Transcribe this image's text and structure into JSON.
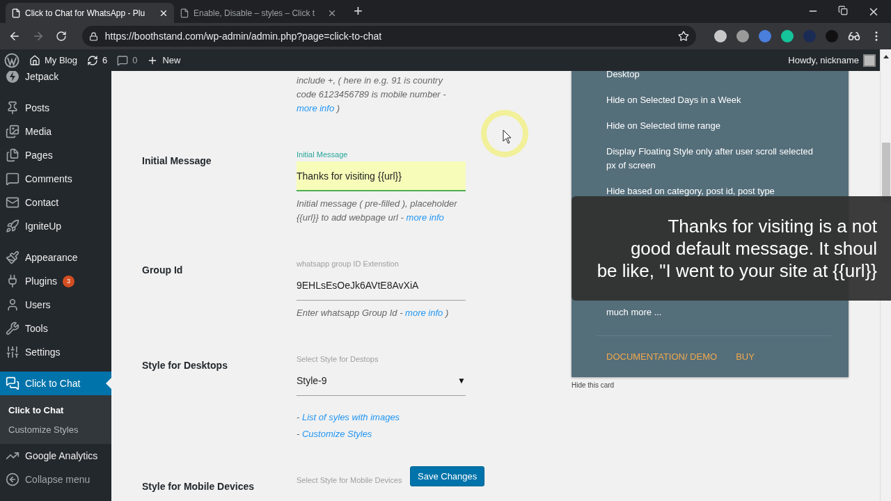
{
  "browser": {
    "tabs": [
      {
        "title": "Click to Chat for WhatsApp - Plu",
        "selected": true
      },
      {
        "title": "Enable, Disable – styles – Click t",
        "selected": false
      }
    ],
    "new_tab": "+",
    "url": "https://boothstand.com/wp-admin/admin.php?page=click-to-chat"
  },
  "admin_bar": {
    "site": "My Blog",
    "updates": "6",
    "comments": "0",
    "new": "New",
    "greeting": "Howdy, nickname"
  },
  "sidebar": {
    "groups": [
      [
        {
          "label": "Jetpack",
          "selected": false
        }
      ],
      [
        {
          "label": "Posts",
          "selected": false
        },
        {
          "label": "Media",
          "selected": false
        },
        {
          "label": "Pages",
          "selected": false
        },
        {
          "label": "Comments",
          "selected": false
        },
        {
          "label": "Contact",
          "selected": false
        },
        {
          "label": "IgniteUp",
          "selected": false
        }
      ],
      [
        {
          "label": "Appearance",
          "selected": false
        },
        {
          "label": "Plugins",
          "selected": false,
          "badge": "3"
        },
        {
          "label": "Users",
          "selected": false
        },
        {
          "label": "Tools",
          "selected": false
        },
        {
          "label": "Settings",
          "selected": false
        }
      ],
      [
        {
          "label": "Click to Chat",
          "selected": true,
          "children": [
            {
              "label": "Click to Chat",
              "selected": true
            },
            {
              "label": "Customize Styles",
              "selected": false
            }
          ]
        },
        {
          "label": "Google Analytics",
          "selected": false
        },
        {
          "label": "Collapse menu",
          "selected": false,
          "kind": "collapse"
        }
      ]
    ]
  },
  "form": {
    "rows": [
      {
        "kind": "description",
        "description": {
          "before": "include +, ( here in e.g. 91 is country code 6123456789 is mobile number - ",
          "link": "more info",
          "after": " )"
        }
      },
      {
        "kind": "text",
        "label": "Initial Message",
        "field_label": "Initial Message",
        "value": "Thanks for visiting {{url}}",
        "focused": true,
        "description": {
          "before": "Initial message ( pre-filled ), placeholder {{url}} to add webpage url - ",
          "link": "more info"
        }
      },
      {
        "kind": "text",
        "label": "Group Id",
        "field_label": "whatsapp group ID Extenstion",
        "value": "9EHLsEsOeJk6AVtE8AvXiA",
        "focused": false,
        "description": {
          "before": "Enter whatsapp Group Id - ",
          "link": "more info",
          "after": " )"
        }
      },
      {
        "kind": "select",
        "label": "Style for Desktops",
        "field_label": "Select Style for Destops",
        "value": "Style-9",
        "caret": "▼",
        "links": [
          {
            "prefix": "- ",
            "link": "List of syles with images"
          },
          {
            "prefix": "- ",
            "link": "Customize Styles"
          }
        ]
      },
      {
        "kind": "select",
        "label": "Style for Mobile Devices",
        "field_label": "Select Style for Mobile Devices"
      }
    ],
    "save_button": "Save Changes"
  },
  "card": {
    "items": [
      "Desktop",
      "Hide on Selected Days in a Week",
      "Hide on Selected time range",
      "Display Floating Style only after user scroll selected px of screen",
      "Hide based on category, post id, post type",
      "much more ..."
    ],
    "links": [
      "DOCUMENTATION/ DEMO",
      "BUY"
    ],
    "hide": "Hide this card"
  },
  "caption": {
    "lines": [
      "Thanks for visiting is a not",
      "good default message. It shoul",
      "be like, \"I went to your site at {{url}}"
    ]
  }
}
